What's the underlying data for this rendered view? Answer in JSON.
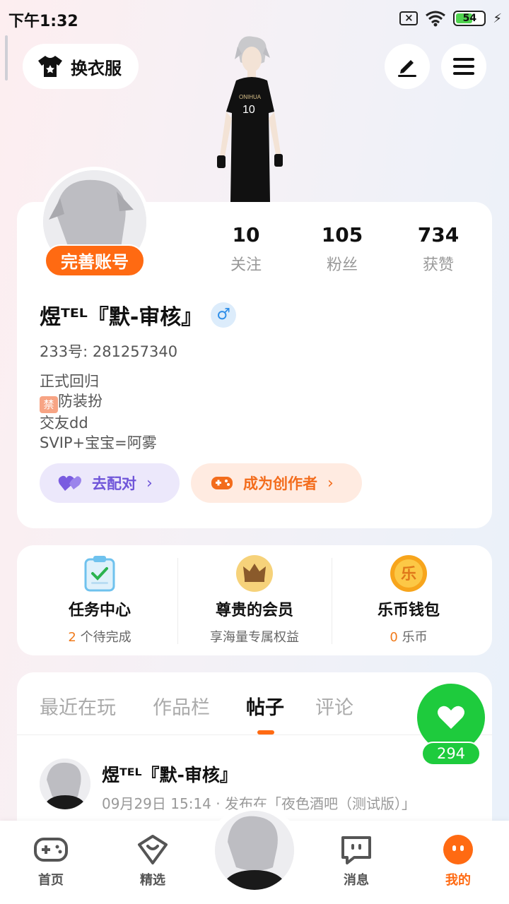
{
  "status_bar": {
    "time": "下午1:32",
    "battery": "54"
  },
  "header": {
    "outfit_label": "换衣服"
  },
  "profile": {
    "complete_label": "完善账号",
    "stats": [
      {
        "value": "10",
        "label": "关注"
      },
      {
        "value": "105",
        "label": "粉丝"
      },
      {
        "value": "734",
        "label": "获赞"
      }
    ],
    "username": "煜ᵀᴱᴸ『默-审核』",
    "gender_symbol": "♂",
    "uid": "233号: 281257340",
    "bio": [
      "正式回归",
      "防装扮",
      "交友dd",
      "SVIP+宝宝=阿雾"
    ],
    "ban_icon_text": "禁",
    "match_label": "去配对",
    "creator_label": "成为创作者"
  },
  "services": [
    {
      "title": "任务中心",
      "count": "2",
      "sub": " 个待完成",
      "icon": "clipboard-check-icon"
    },
    {
      "title": "尊贵的会员",
      "count": "",
      "sub": "享海量专属权益",
      "icon": "crown-icon"
    },
    {
      "title": "乐币钱包",
      "count": "0",
      "sub": " 乐币",
      "icon": "coin-icon",
      "coin_char": "乐"
    }
  ],
  "tabs": [
    "最近在玩",
    "作品栏",
    "帖子",
    "评论"
  ],
  "active_tab": "帖子",
  "post": {
    "author": "煜ᵀᴱᴸ『默-审核』",
    "meta": "09月29日 15:14 · 发布在「夜色酒吧（测试版）」"
  },
  "heart": {
    "count": "294"
  },
  "bottom_nav": [
    {
      "label": "首页",
      "icon": "gamepad-icon"
    },
    {
      "label": "精选",
      "icon": "heart-box-icon"
    },
    {
      "label": "消息",
      "icon": "chat-icon"
    },
    {
      "label": "我的",
      "icon": "profile-face-icon"
    }
  ],
  "colors": {
    "accent": "#ff6a12",
    "green": "#1ecb3d",
    "purple": "#6f55d9"
  }
}
